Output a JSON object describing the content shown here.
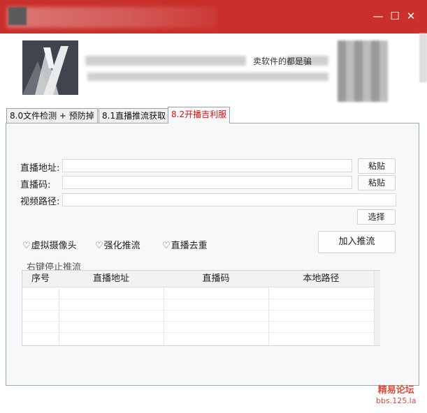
{
  "window": {
    "minimize_glyph": "—",
    "maximize_glyph": "☐",
    "close_glyph": "✕"
  },
  "header": {
    "banner_text": "卖软件的都是骗"
  },
  "tabs": [
    {
      "label": "8.0文件检测 + 预防掉",
      "active": false
    },
    {
      "label": "8.1直播推流获取",
      "active": false
    },
    {
      "label": "8.2开播吉利服",
      "active": true
    }
  ],
  "form": {
    "live_address_label": "直播地址:",
    "live_address_value": "",
    "live_code_label": "直播码:",
    "live_code_value": "",
    "video_path_label": "视频路径:",
    "video_path_value": "",
    "paste_label": "粘贴",
    "select_label": "选择"
  },
  "options": [
    {
      "label": "虚拟摄像头",
      "checked": false
    },
    {
      "label": "强化推流",
      "checked": false
    },
    {
      "label": "直播去重",
      "checked": false
    }
  ],
  "add_stream_label": "加入推流",
  "stream_group": {
    "title": "右键停止推流",
    "columns": [
      "序号",
      "直播地址",
      "直播码",
      "本地路径"
    ],
    "rows": []
  },
  "watermark": {
    "name": "精易论坛",
    "url": "bbs.125.la"
  },
  "colors": {
    "titlebar": "#c9302c",
    "active_tab_text": "#dd1111",
    "watermark": "#d94a3a"
  },
  "icons": {
    "check": "heart-icon"
  }
}
